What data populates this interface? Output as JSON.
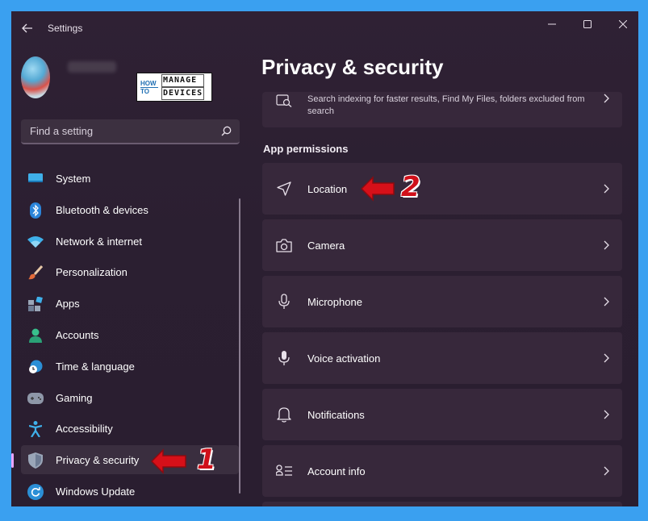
{
  "window": {
    "title": "Settings"
  },
  "profile": {
    "brand_logo": {
      "how": "HOW",
      "to": "TO",
      "line1": "MANAGE",
      "line2": "DEVICES"
    }
  },
  "search": {
    "placeholder": "Find a setting"
  },
  "sidebar": {
    "items": [
      {
        "label": "System",
        "icon": "monitor-icon"
      },
      {
        "label": "Bluetooth & devices",
        "icon": "bluetooth-icon"
      },
      {
        "label": "Network & internet",
        "icon": "wifi-icon"
      },
      {
        "label": "Personalization",
        "icon": "brush-icon"
      },
      {
        "label": "Apps",
        "icon": "apps-icon"
      },
      {
        "label": "Accounts",
        "icon": "person-icon"
      },
      {
        "label": "Time & language",
        "icon": "globe-clock-icon"
      },
      {
        "label": "Gaming",
        "icon": "gamepad-icon"
      },
      {
        "label": "Accessibility",
        "icon": "accessibility-icon"
      },
      {
        "label": "Privacy & security",
        "icon": "shield-icon",
        "active": true
      },
      {
        "label": "Windows Update",
        "icon": "update-icon"
      }
    ]
  },
  "main": {
    "title": "Privacy & security",
    "search_card_desc": "Search indexing for faster results, Find My Files, folders excluded from search",
    "section_heading": "App permissions",
    "cards": [
      {
        "label": "Location",
        "icon": "location-arrow-icon"
      },
      {
        "label": "Camera",
        "icon": "camera-icon"
      },
      {
        "label": "Microphone",
        "icon": "microphone-icon"
      },
      {
        "label": "Voice activation",
        "icon": "voice-mic-icon"
      },
      {
        "label": "Notifications",
        "icon": "bell-icon"
      },
      {
        "label": "Account info",
        "icon": "account-info-icon"
      }
    ]
  },
  "annotations": {
    "step1": "1",
    "step2": "2"
  },
  "colors": {
    "background": "#3aa0f0",
    "window": "#2f2134",
    "card": "#37283b",
    "highlight": "#e2e800",
    "annotation_red": "#d0101a",
    "accent_pill": "#e9a4ff"
  }
}
